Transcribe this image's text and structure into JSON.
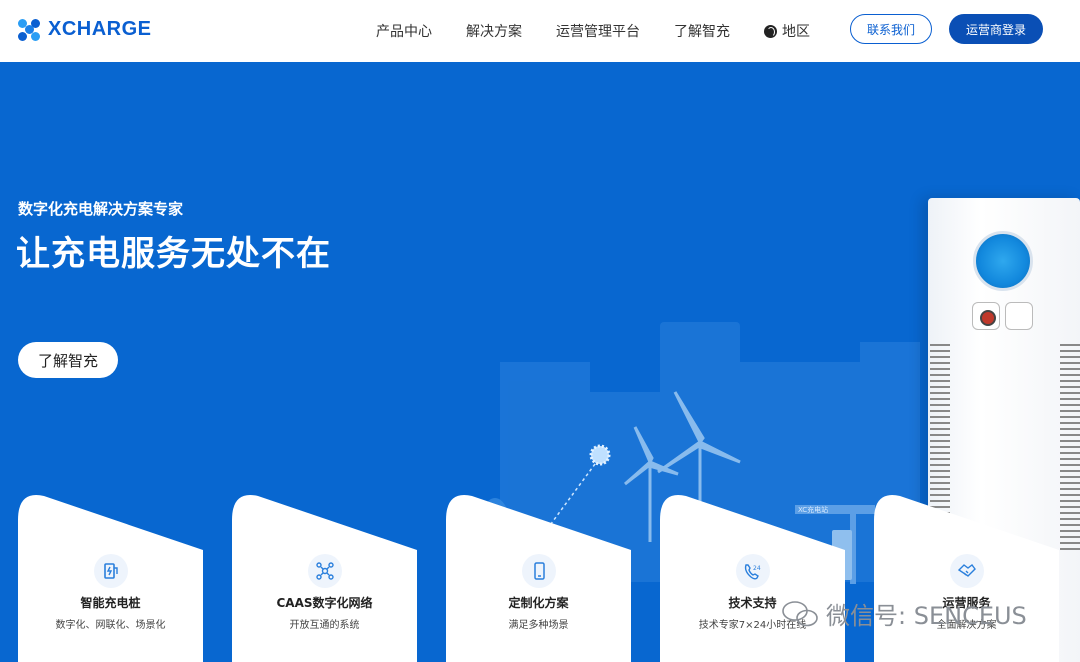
{
  "header": {
    "brand": "XCHARGE",
    "nav": [
      {
        "label": "产品中心"
      },
      {
        "label": "解决方案"
      },
      {
        "label": "运营管理平台"
      },
      {
        "label": "了解智充"
      },
      {
        "label": "地区"
      }
    ],
    "contact_label": "联系我们",
    "login_label": "运营商登录"
  },
  "hero": {
    "subtitle": "数字化充电解决方案专家",
    "title": "让充电服务无处不在",
    "cta_label": "了解智充",
    "station_sign": "XC充电站"
  },
  "cards": [
    {
      "title": "智能充电桩",
      "desc": "数字化、网联化、场景化",
      "icon": "charger-icon"
    },
    {
      "title": "CAAS数字化网络",
      "desc": "开放互通的系统",
      "icon": "network-icon"
    },
    {
      "title": "定制化方案",
      "desc": "满足多种场景",
      "icon": "phone-icon"
    },
    {
      "title": "技术支持",
      "desc": "技术专家7×24小时在线",
      "icon": "support-24-icon"
    },
    {
      "title": "运营服务",
      "desc": "全面解决方案",
      "icon": "handshake-icon"
    }
  ],
  "watermark": "微信号: SENCEUS",
  "colors": {
    "brand": "#0a5fd1",
    "hero": "#0867d0",
    "button": "#0a4fb5"
  }
}
